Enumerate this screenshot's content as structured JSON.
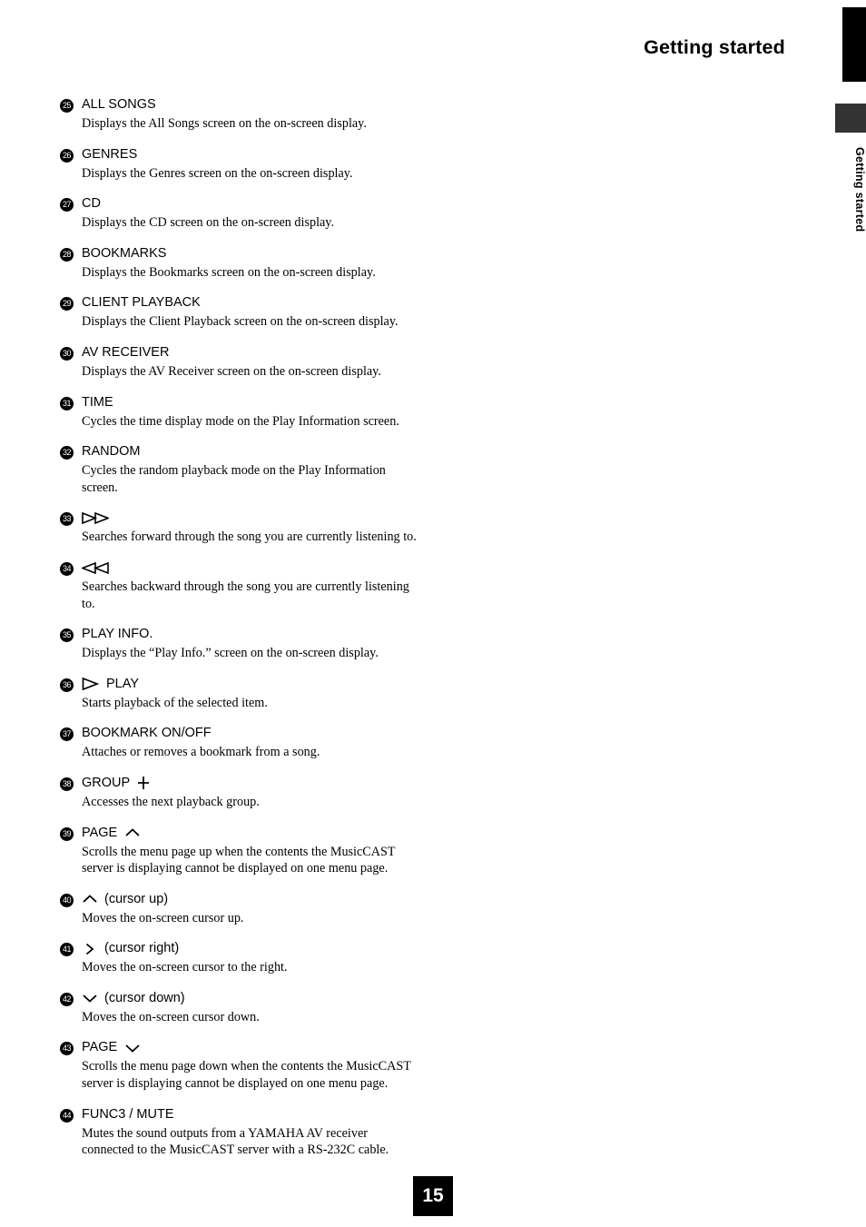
{
  "header": {
    "title": "Getting started",
    "side_tab_label": "Getting started",
    "tab_color": "#000000",
    "side_block_color": "#333333"
  },
  "footer": {
    "page_number": "15"
  },
  "entries": [
    {
      "number": "25",
      "label": "ALL SONGS",
      "description": "Displays the All Songs screen on the on-screen display."
    },
    {
      "number": "26",
      "label": "GENRES",
      "description": "Displays the Genres screen on the on-screen display."
    },
    {
      "number": "27",
      "label": "CD",
      "description": "Displays the CD screen on the on-screen display."
    },
    {
      "number": "28",
      "label": "BOOKMARKS",
      "description": "Displays the Bookmarks screen on the on-screen display."
    },
    {
      "number": "29",
      "label": "CLIENT PLAYBACK",
      "description": "Displays the Client Playback screen on the on-screen display."
    },
    {
      "number": "30",
      "label": "AV RECEIVER",
      "description": "Displays the AV Receiver screen on the on-screen display."
    },
    {
      "number": "31",
      "label": "TIME",
      "description": "Cycles the time display mode on the Play Information screen."
    },
    {
      "number": "32",
      "label": "RANDOM",
      "description": "Cycles the random playback mode on the Play Information screen."
    },
    {
      "number": "33",
      "label": "",
      "icon": "fast-forward-icon",
      "icon_position": "before",
      "description": "Searches forward through the song you are currently listening to."
    },
    {
      "number": "34",
      "label": "",
      "icon": "rewind-icon",
      "icon_position": "before",
      "description": "Searches backward through the song you are currently listening to."
    },
    {
      "number": "35",
      "label": "PLAY INFO.",
      "description": "Displays the “Play Info.” screen on the on-screen display."
    },
    {
      "number": "36",
      "label": "PLAY",
      "icon": "play-icon",
      "icon_position": "before",
      "description": "Starts playback of the selected item."
    },
    {
      "number": "37",
      "label": "BOOKMARK ON/OFF",
      "description": "Attaches or removes a bookmark from a song."
    },
    {
      "number": "38",
      "label": "GROUP",
      "icon": "plus-icon",
      "icon_position": "after",
      "description": "Accesses the next playback group."
    },
    {
      "number": "39",
      "label": "PAGE",
      "icon": "chevron-up-icon",
      "icon_position": "after",
      "description": "Scrolls the menu page up when the contents the MusicCAST server is displaying cannot be displayed on one menu page."
    },
    {
      "number": "40",
      "label": "(cursor up)",
      "icon": "chevron-up-icon",
      "icon_position": "before",
      "description": "Moves the on-screen cursor up."
    },
    {
      "number": "41",
      "label": "(cursor right)",
      "icon": "chevron-right-icon",
      "icon_position": "before",
      "description": "Moves the on-screen cursor to the right."
    },
    {
      "number": "42",
      "label": "(cursor down)",
      "icon": "chevron-down-icon",
      "icon_position": "before",
      "description": "Moves the on-screen cursor down."
    },
    {
      "number": "43",
      "label": "PAGE",
      "icon": "chevron-down-icon",
      "icon_position": "after",
      "description": "Scrolls the menu page down when the contents the MusicCAST server is displaying cannot be displayed on one menu page."
    },
    {
      "number": "44",
      "label": "FUNC3 / MUTE",
      "description": "Mutes the sound outputs from a YAMAHA AV receiver connected to the MusicCAST server with a RS-232C cable."
    }
  ]
}
